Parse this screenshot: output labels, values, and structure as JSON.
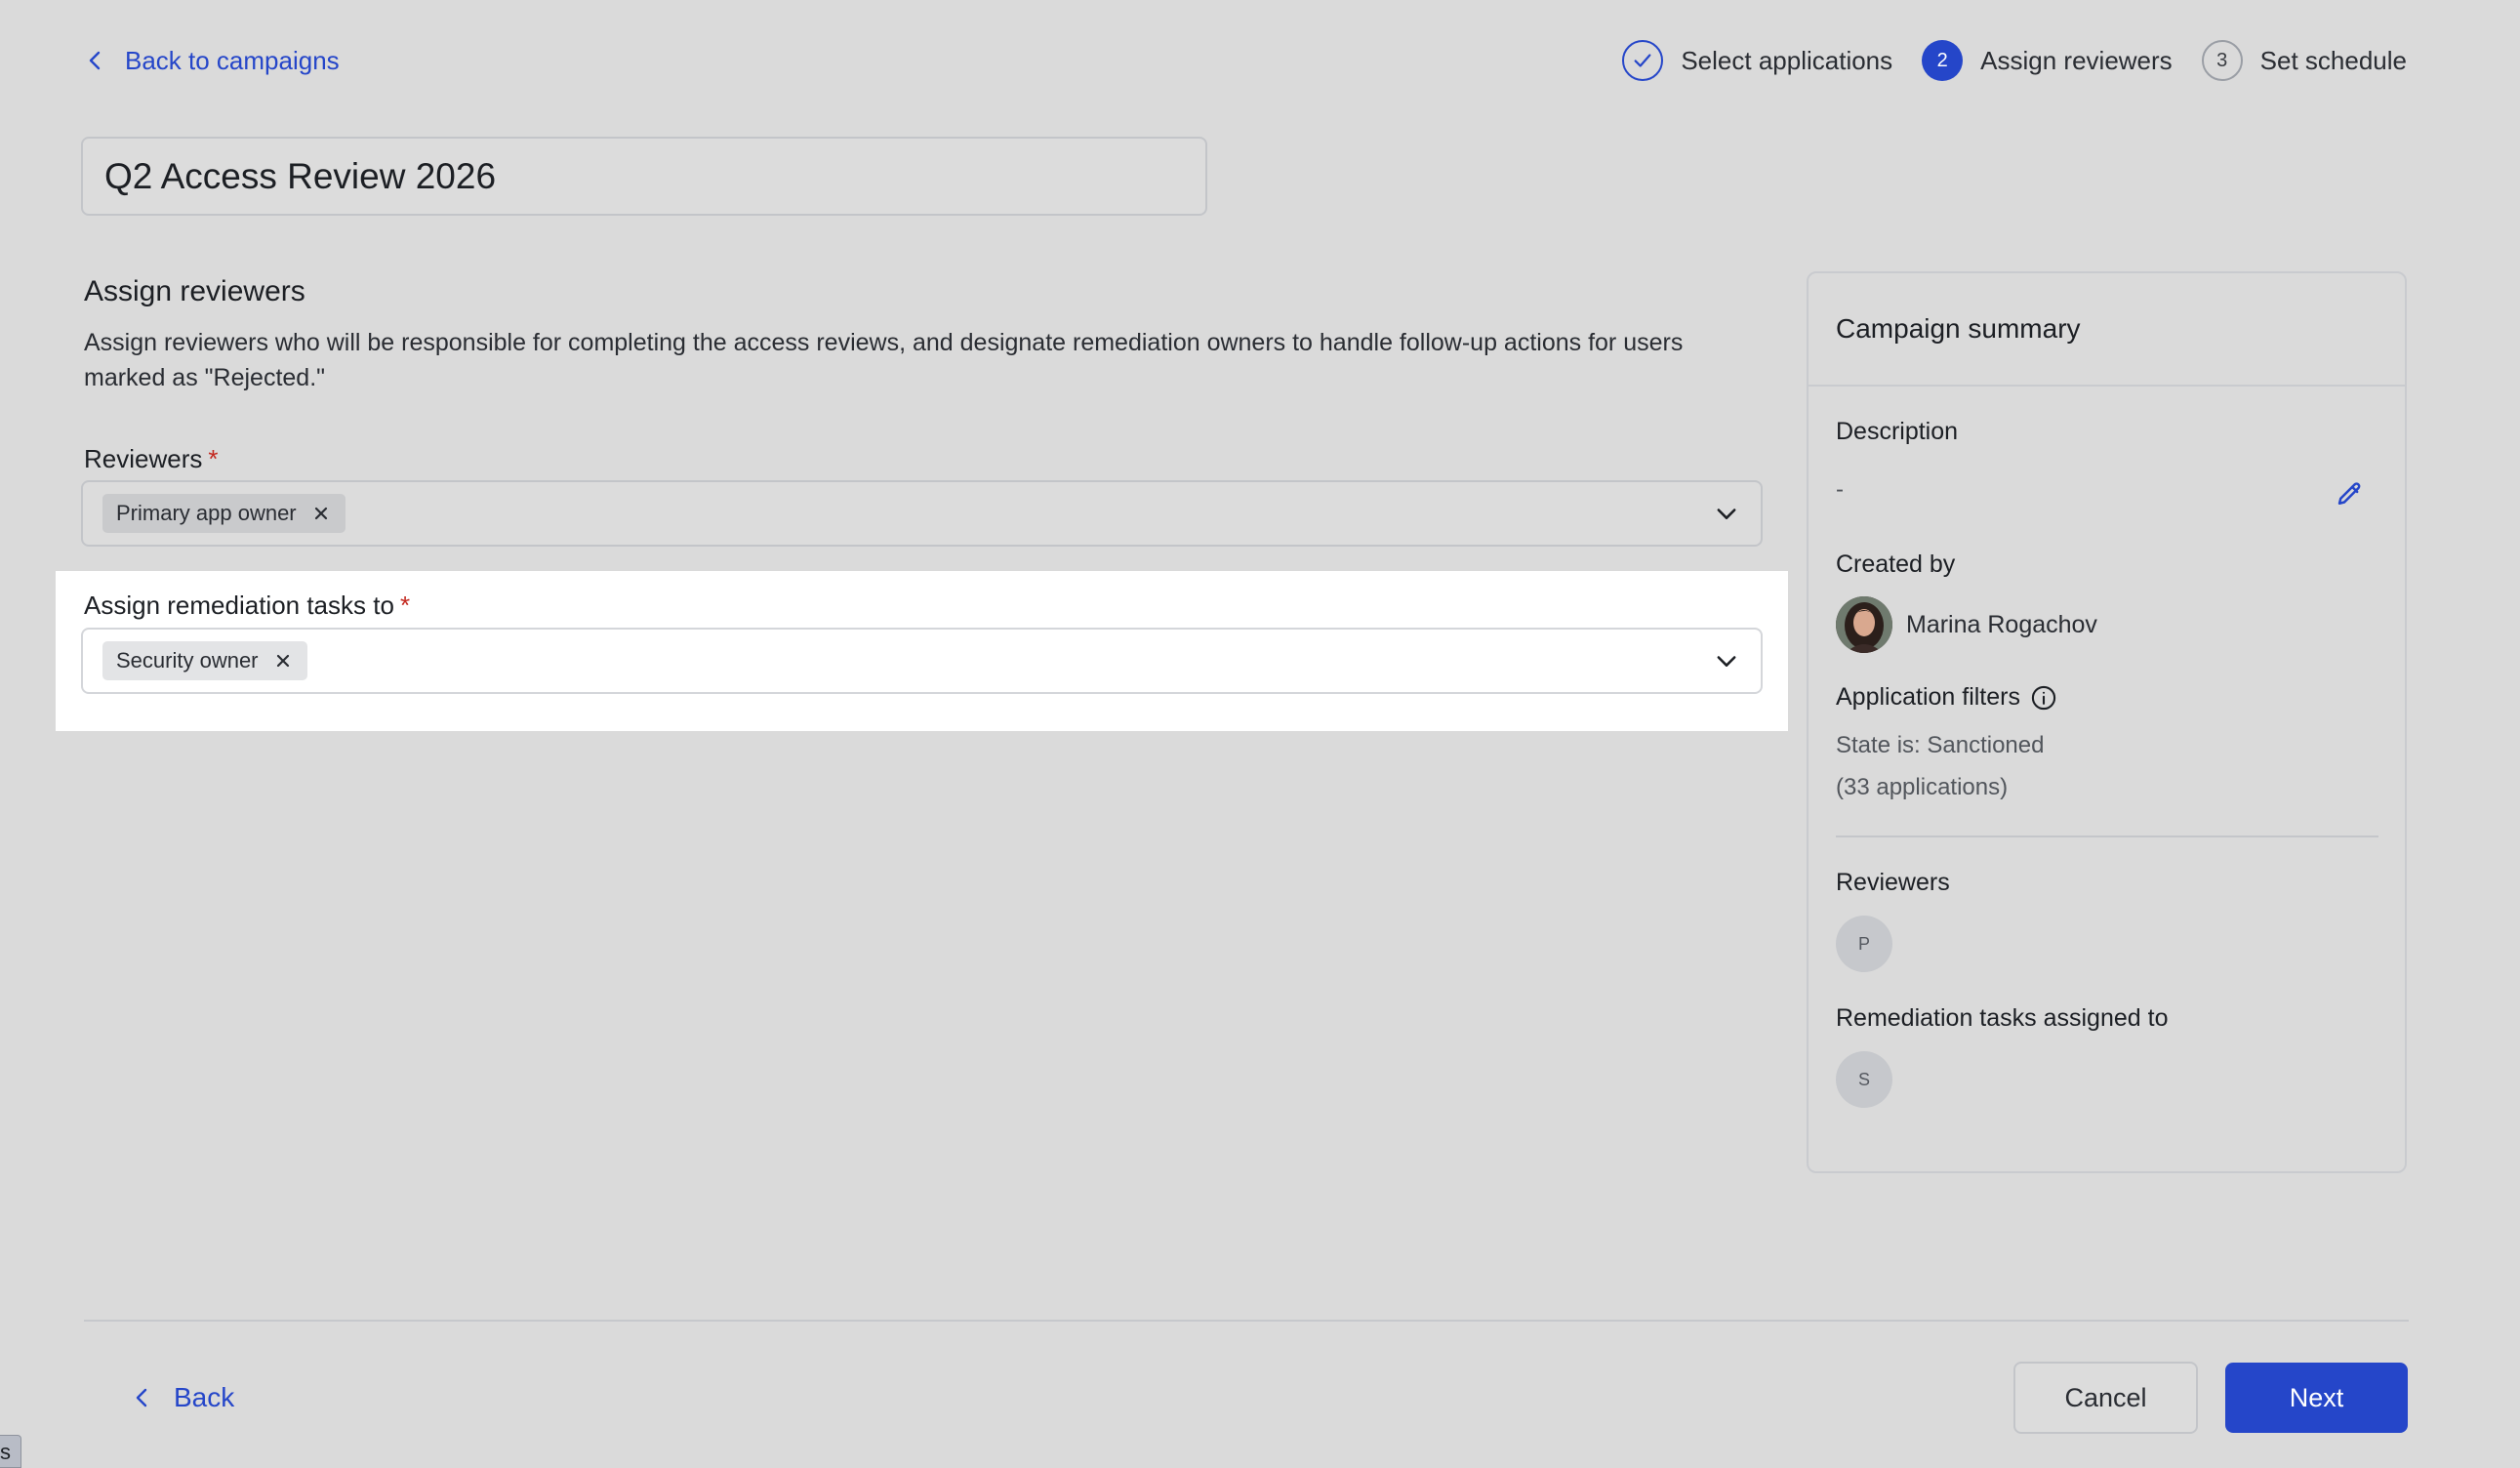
{
  "nav": {
    "back_label": "Back to campaigns"
  },
  "stepper": {
    "steps": [
      {
        "number": "",
        "label": "Select applications",
        "state": "done"
      },
      {
        "number": "2",
        "label": "Assign reviewers",
        "state": "active"
      },
      {
        "number": "3",
        "label": "Set schedule",
        "state": "pending"
      }
    ]
  },
  "campaign": {
    "name": "Q2 Access Review 2026"
  },
  "section": {
    "title": "Assign reviewers",
    "description": "Assign reviewers who will be responsible for completing the access reviews, and designate remediation owners to handle follow-up actions for users marked as \"Rejected.\""
  },
  "reviewers": {
    "label": "Reviewers",
    "required_mark": "*",
    "selected": [
      "Primary app owner"
    ]
  },
  "remediation": {
    "label": "Assign remediation tasks to",
    "required_mark": "*",
    "selected": [
      "Security owner"
    ]
  },
  "summary": {
    "title": "Campaign summary",
    "description_label": "Description",
    "description_value": "-",
    "created_by_label": "Created by",
    "created_by_name": "Marina Rogachov",
    "filters_label": "Application filters",
    "filter_line1": "State is: Sanctioned",
    "filter_line2": "(33 applications)",
    "reviewers_label": "Reviewers",
    "reviewers_initial": "P",
    "remediation_label": "Remediation tasks assigned to",
    "remediation_initial": "S"
  },
  "footer": {
    "back_label": "Back",
    "cancel_label": "Cancel",
    "next_label": "Next"
  },
  "corner_tab": {
    "text": "s"
  },
  "colors": {
    "accent": "#2546c9",
    "required": "#c3281f",
    "background": "#dadada"
  }
}
